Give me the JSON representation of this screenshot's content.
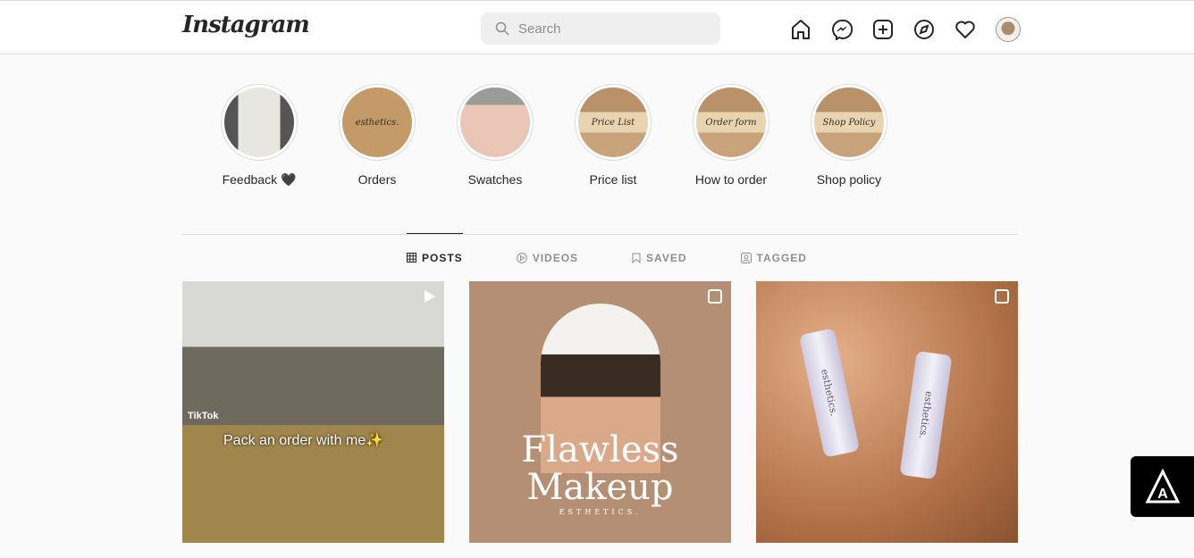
{
  "header": {
    "logo": "Instagram",
    "search_placeholder": "Search"
  },
  "nav": [
    "home-icon",
    "messenger-icon",
    "new-post-icon",
    "explore-icon",
    "activity-heart-icon",
    "profile-avatar"
  ],
  "highlights": [
    {
      "label": "Feedback 🖤",
      "cover": ""
    },
    {
      "label": "Orders",
      "cover": "esthetics."
    },
    {
      "label": "Swatches",
      "cover": ""
    },
    {
      "label": "Price list",
      "cover": "Price List"
    },
    {
      "label": "How to order",
      "cover": "Order form"
    },
    {
      "label": "Shop policy",
      "cover": "Shop Policy"
    }
  ],
  "tabs": [
    {
      "label": "POSTS",
      "active": true
    },
    {
      "label": "VIDEOS"
    },
    {
      "label": "SAVED"
    },
    {
      "label": "TAGGED"
    }
  ],
  "posts": [
    {
      "type": "video",
      "tiktok": "TikTok",
      "caption": "Pack an order with me✨"
    },
    {
      "type": "carousel",
      "title1": "Flawless",
      "title2": "Makeup",
      "brand": "ESTHETICS."
    },
    {
      "type": "carousel",
      "tube1": "esthetics.",
      "tube2": "esthetics."
    }
  ]
}
